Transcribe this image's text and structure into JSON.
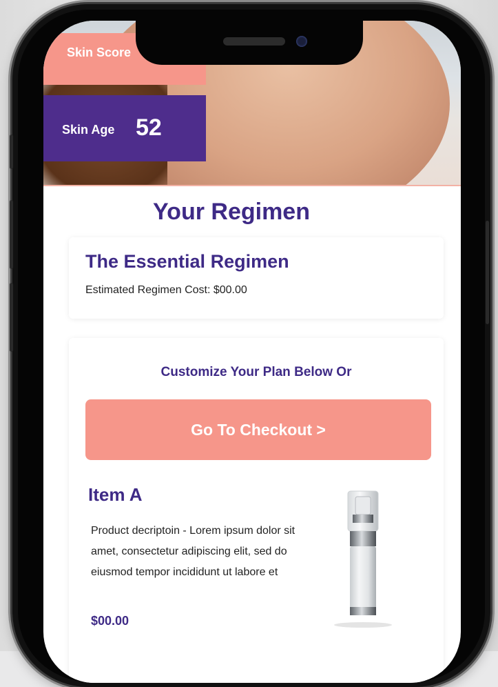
{
  "hero": {
    "skin_score_label": "Skin Score",
    "skin_age_label": "Skin Age",
    "skin_age_value": "52"
  },
  "regimen": {
    "heading": "Your Regimen",
    "plan_name": "The Essential Regimen",
    "cost_text": "Estimated Regimen Cost: $00.00"
  },
  "plan": {
    "customize_text": "Customize Your Plan Below Or",
    "checkout_label": "Go To Checkout >"
  },
  "item": {
    "name": "Item A",
    "description": "Product decriptoin - Lorem ipsum dolor sit amet, consectetur adipiscing elit, sed do eiusmod tempor incididunt ut labore et",
    "price": "$00.00",
    "image_icon": "serum-bottle-icon"
  },
  "colors": {
    "brand_purple": "#4e2d8c",
    "text_purple": "#3e2a86",
    "coral": "#f6968a"
  }
}
